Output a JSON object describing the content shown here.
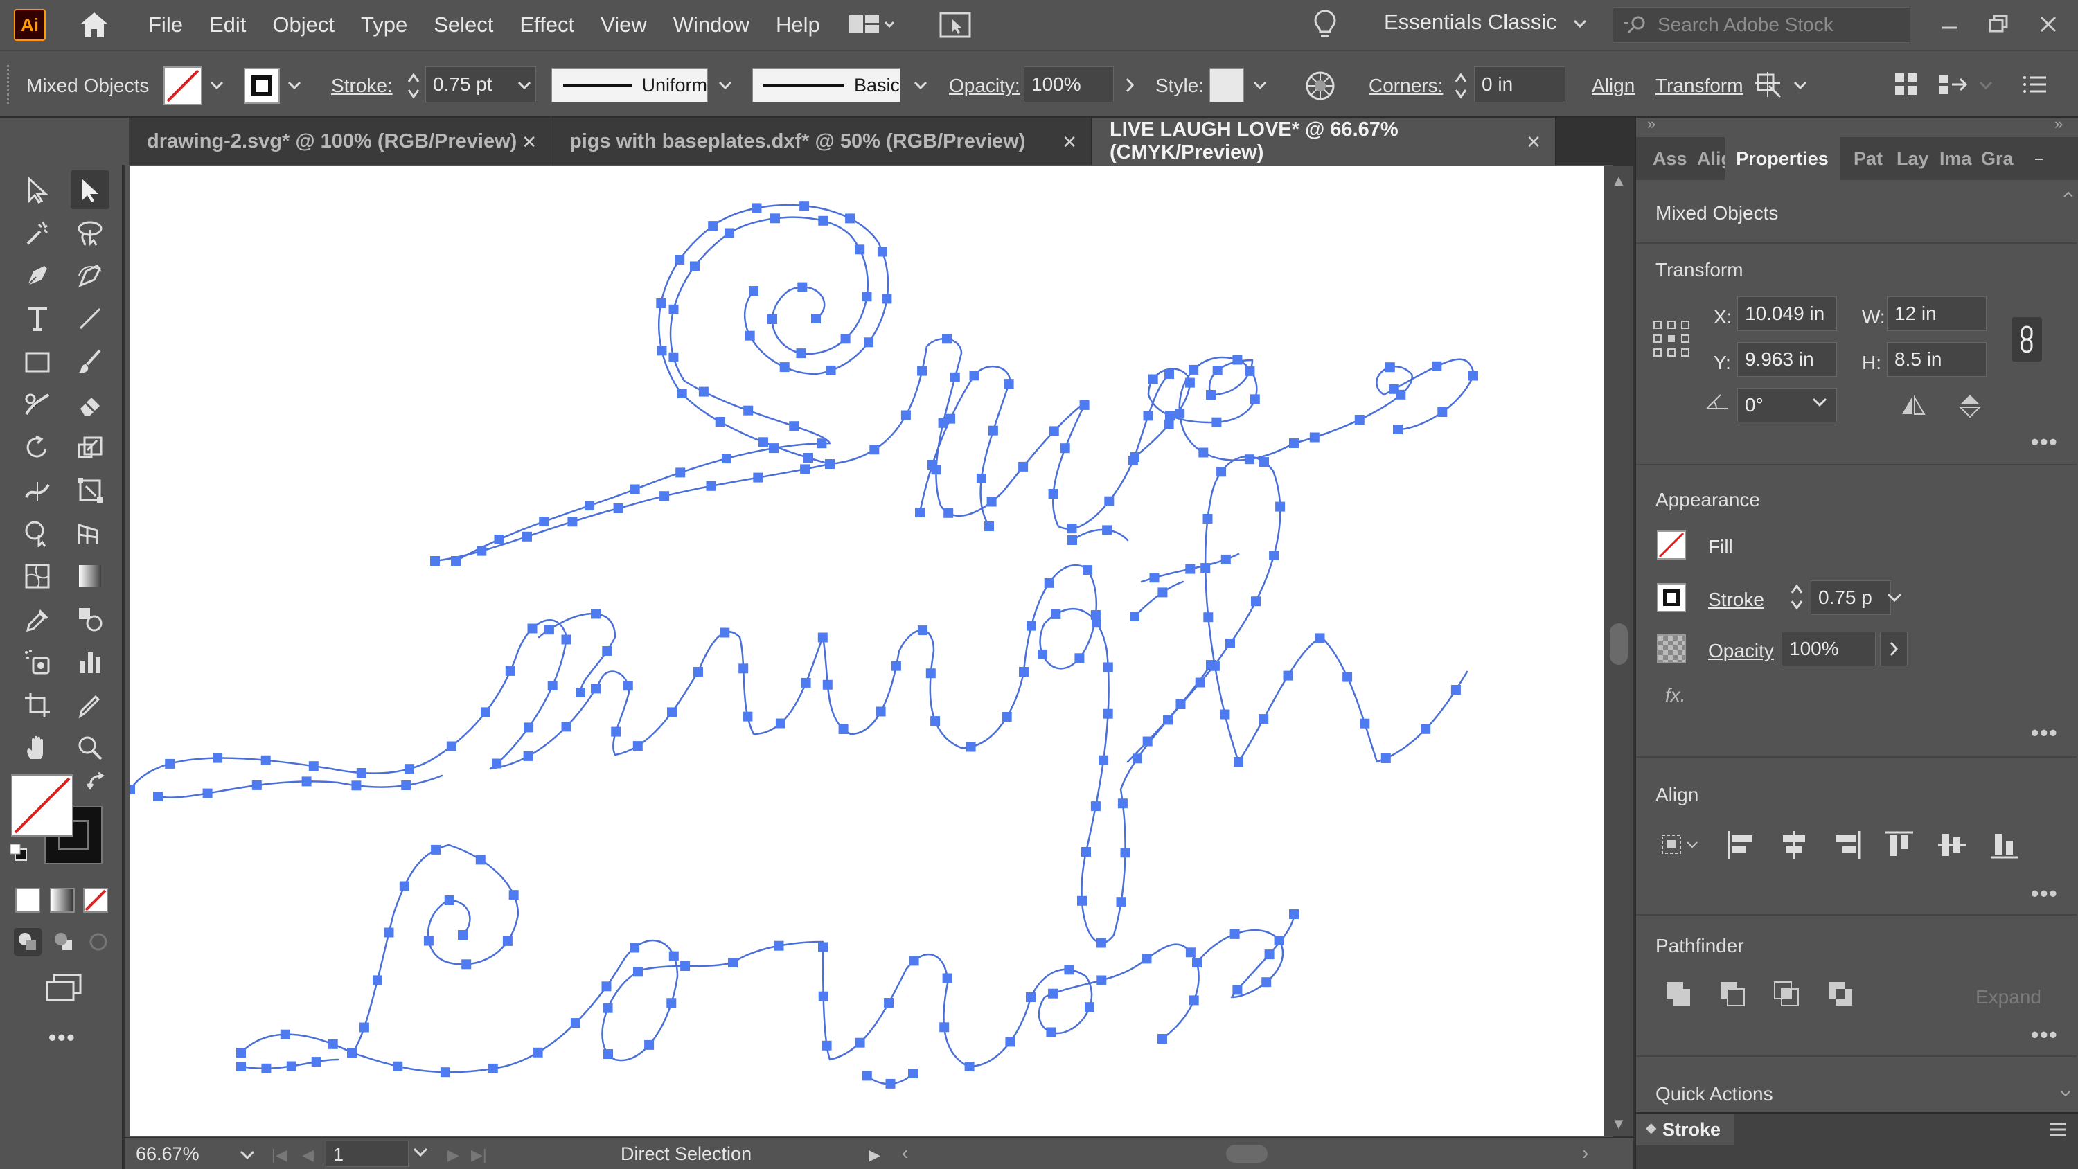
{
  "app": {
    "logo": "Ai"
  },
  "menu": [
    "File",
    "Edit",
    "Object",
    "Type",
    "Select",
    "Effect",
    "View",
    "Window",
    "Help"
  ],
  "workspace": {
    "label": "Essentials Classic"
  },
  "search": {
    "placeholder": "Search Adobe Stock"
  },
  "control_bar": {
    "selection_label": "Mixed Objects",
    "stroke_label": "Stroke:",
    "stroke_value": "0.75 pt",
    "profile_label": "Uniform",
    "brush_label": "Basic",
    "opacity_label": "Opacity:",
    "opacity_value": "100%",
    "style_label": "Style:",
    "corners_label": "Corners:",
    "corners_value": "0 in",
    "align_label": "Align",
    "transform_label": "Transform"
  },
  "tabs": [
    {
      "label": "drawing-2.svg* @ 100% (RGB/Preview)"
    },
    {
      "label": "pigs with baseplates.dxf* @ 50% (RGB/Preview)"
    },
    {
      "label": "LIVE LAUGH LOVE* @ 66.67% (CMYK/Preview)"
    }
  ],
  "status": {
    "zoom": "66.67%",
    "artboard": "1",
    "tool": "Direct Selection"
  },
  "properties_panel": {
    "tabs": [
      "Ass",
      "Alig",
      "Properties",
      "Pat",
      "Lay",
      "Ima",
      "Gra"
    ],
    "selection": "Mixed Objects",
    "transform": {
      "title": "Transform",
      "x_label": "X:",
      "x": "10.049 in",
      "y_label": "Y:",
      "y": "9.963 in",
      "w_label": "W:",
      "w": "12 in",
      "h_label": "H:",
      "h": "8.5 in",
      "angle": "0°"
    },
    "appearance": {
      "title": "Appearance",
      "fill_label": "Fill",
      "stroke_label": "Stroke",
      "stroke_value": "0.75 p",
      "opacity_label": "Opacity",
      "opacity_value": "100%",
      "fx_label": "fx."
    },
    "align": {
      "title": "Align"
    },
    "pathfinder": {
      "title": "Pathfinder",
      "expand_label": "Expand"
    },
    "quick_actions": {
      "title": "Quick Actions"
    },
    "stroke_panel": {
      "title": "Stroke"
    }
  },
  "colors": {
    "path_stroke": "#4a6fd8",
    "anchor_fill": "#4e7cf0",
    "accent_orange": "#ff9a00"
  }
}
